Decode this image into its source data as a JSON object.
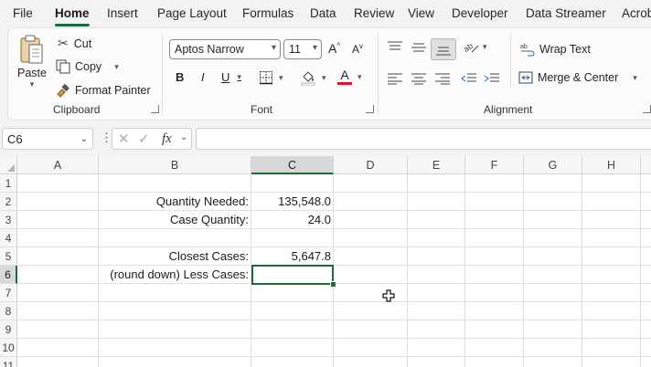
{
  "menu": {
    "tabs": [
      "File",
      "Home",
      "Insert",
      "Page Layout",
      "Formulas",
      "Data",
      "Review",
      "View",
      "Developer",
      "Data Streamer",
      "Acrob"
    ],
    "active_tab": "Home"
  },
  "ribbon": {
    "clipboard": {
      "paste_label": "Paste",
      "cut_label": "Cut",
      "copy_label": "Copy",
      "format_painter_label": "Format Painter",
      "group_label": "Clipboard"
    },
    "font": {
      "font_name": "Aptos Narrow",
      "font_size": "11",
      "bold_label": "B",
      "italic_label": "I",
      "underline_label": "U",
      "font_color_label": "A",
      "group_label": "Font"
    },
    "alignment": {
      "wrap_text_label": "Wrap Text",
      "merge_center_label": "Merge & Center",
      "group_label": "Alignment"
    }
  },
  "formula_bar": {
    "name_box": "C6",
    "fx_label": "fx",
    "formula": ""
  },
  "sheet": {
    "columns": [
      "A",
      "B",
      "C",
      "D",
      "E",
      "F",
      "G",
      "H"
    ],
    "selected_column": "C",
    "rows": [
      "1",
      "2",
      "3",
      "4",
      "5",
      "6",
      "7",
      "8",
      "9",
      "10",
      "11"
    ],
    "selected_row": "6",
    "cells": {
      "B2": "Quantity Needed:",
      "C2": "135,548.0",
      "B3": "Case Quantity:",
      "C3": "24.0",
      "B5": "Closest Cases:",
      "C5": "5,647.8",
      "B6": "(round down) Less Cases:",
      "C6": ""
    }
  },
  "colors": {
    "accent": "#1d6b3b",
    "font_color_bar": "#e81123"
  }
}
